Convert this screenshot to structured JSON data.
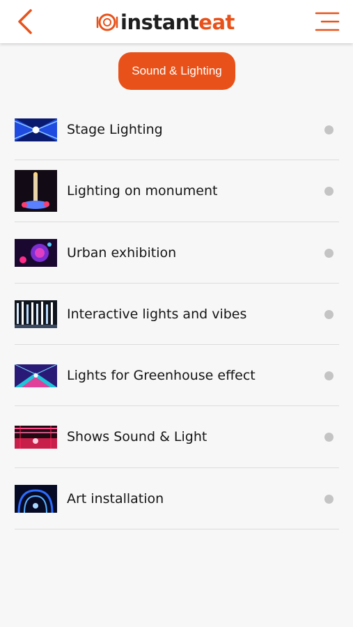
{
  "header": {
    "logo_part1": "instant",
    "logo_part2": "eat",
    "icons": {
      "back": "chevron-left-icon",
      "menu": "hamburger-menu-icon",
      "logo": "plate-logo-icon"
    }
  },
  "category": {
    "label": "Sound & Lighting"
  },
  "colors": {
    "accent": "#e8521a",
    "text": "#141414",
    "divider": "#dcdcdc",
    "dot": "#c4c4c4",
    "background": "#f7f7f7"
  },
  "items": [
    {
      "label": "Stage Lighting"
    },
    {
      "label": "Lighting on monument"
    },
    {
      "label": "Urban exhibition"
    },
    {
      "label": "Interactive lights and vibes"
    },
    {
      "label": "Lights for Greenhouse effect"
    },
    {
      "label": "Shows Sound & Light"
    },
    {
      "label": "Art installation"
    }
  ]
}
